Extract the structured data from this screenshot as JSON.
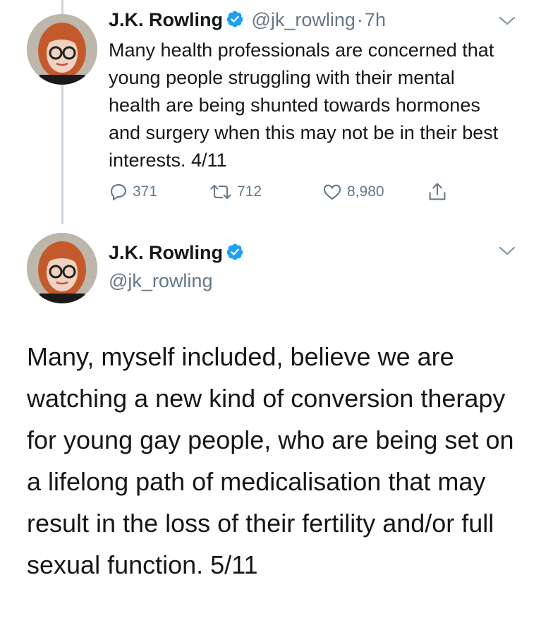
{
  "colors": {
    "text": "#14171a",
    "secondary": "#657786",
    "verified": "#1da1f2",
    "thread_line": "#ccd6dd"
  },
  "tweet1": {
    "name": "J.K. Rowling",
    "handle": "@jk_rowling",
    "separator": "·",
    "time": "7h",
    "text": "Many health professionals are concerned that young people struggling with their mental health are being shunted towards hormones and surgery when this may not be in their best interests. 4/11",
    "replies": "371",
    "retweets": "712",
    "likes": "8,980",
    "icons": [
      "reply-icon",
      "retweet-icon",
      "like-icon",
      "share-icon",
      "chevron-down-icon",
      "verified-badge-icon"
    ]
  },
  "tweet2": {
    "name": "J.K. Rowling",
    "handle": "@jk_rowling",
    "text": "Many, myself included, believe we are watching a new kind of conversion therapy for young gay people, who are being set on a lifelong path of medicalisation that may result in the loss of their fertility and/or full sexual function. 5/11"
  }
}
